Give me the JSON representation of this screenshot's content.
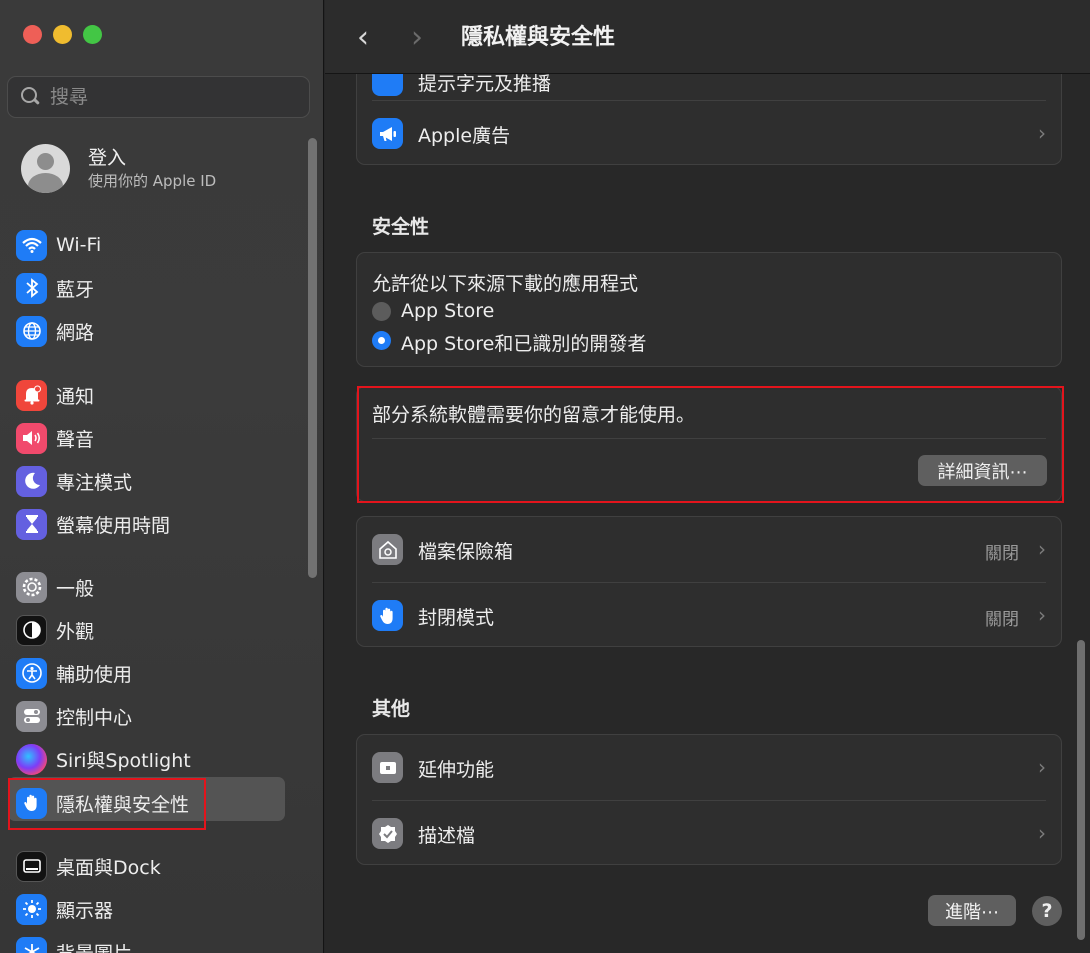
{
  "window": {
    "title": "隱私權與安全性"
  },
  "sidebar": {
    "search_placeholder": "搜尋",
    "account": {
      "title": "登入",
      "subtitle": "使用你的 Apple ID"
    },
    "items": [
      {
        "label": "Wi-Fi",
        "icon": "wifi-icon",
        "color": "#1f7cf6"
      },
      {
        "label": "藍牙",
        "icon": "bluetooth-icon",
        "color": "#1f7cf6"
      },
      {
        "label": "網路",
        "icon": "globe-icon",
        "color": "#1f7cf6"
      },
      {
        "label": "通知",
        "icon": "bell-icon",
        "color": "#f0463b"
      },
      {
        "label": "聲音",
        "icon": "speaker-icon",
        "color": "#f14a6c"
      },
      {
        "label": "專注模式",
        "icon": "moon-icon",
        "color": "#6460e0"
      },
      {
        "label": "螢幕使用時間",
        "icon": "hourglass-icon",
        "color": "#6460e0"
      },
      {
        "label": "一般",
        "icon": "gear-icon",
        "color": "#8d8d93"
      },
      {
        "label": "外觀",
        "icon": "appearance-icon",
        "color": "#121212"
      },
      {
        "label": "輔助使用",
        "icon": "accessibility-icon",
        "color": "#1f7cf6"
      },
      {
        "label": "控制中心",
        "icon": "toggles-icon",
        "color": "#8d8d93"
      },
      {
        "label": "Siri與Spotlight",
        "icon": "siri-icon",
        "color": "#7d3cf7"
      },
      {
        "label": "隱私權與安全性",
        "icon": "hand-icon",
        "color": "#1f7cf6",
        "selected": true
      },
      {
        "label": "桌面與Dock",
        "icon": "dock-icon",
        "color": "#121212"
      },
      {
        "label": "顯示器",
        "icon": "sun-icon",
        "color": "#1f7cf6"
      },
      {
        "label": "背景圖片",
        "icon": "snowflake-icon",
        "color": "#1f7cf6"
      }
    ]
  },
  "main": {
    "toolbar": {
      "back_label": "‹",
      "forward_label": "›",
      "title": "隱私權與安全性"
    },
    "top_card": {
      "partial_label": "提示字元及推播",
      "ads_label": "Apple廣告"
    },
    "security": {
      "section_title": "安全性",
      "downloads_title": "允許從以下來源下載的應用程式",
      "options": [
        {
          "label": "App Store",
          "selected": false
        },
        {
          "label": "App Store和已識別的開發者",
          "selected": true
        }
      ]
    },
    "notice": {
      "message": "部分系統軟體需要你的留意才能使用。",
      "details_button": "詳細資訊⋯"
    },
    "protection": {
      "items": [
        {
          "label": "檔案保險箱",
          "value": "關閉",
          "icon": "house-lock-icon"
        },
        {
          "label": "封閉模式",
          "value": "關閉",
          "icon": "hand-icon"
        }
      ]
    },
    "others": {
      "section_title": "其他",
      "items": [
        {
          "label": "延伸功能",
          "icon": "extension-icon"
        },
        {
          "label": "描述檔",
          "icon": "badge-check-icon"
        }
      ]
    },
    "footer": {
      "advanced_button": "進階⋯",
      "help_button": "?"
    }
  },
  "accent_colors": {
    "highlight_box": "#e3141c",
    "selection_blue": "#1f7cf6"
  }
}
